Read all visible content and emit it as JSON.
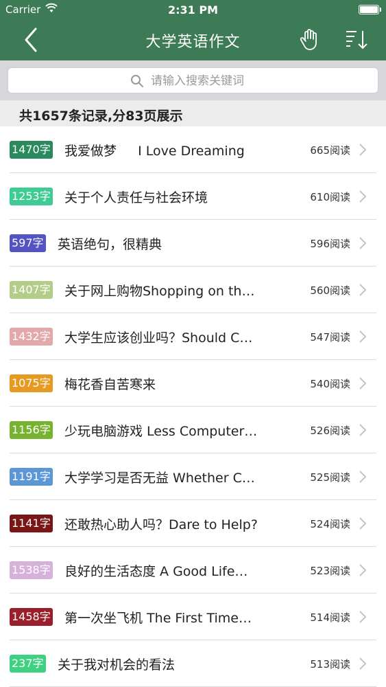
{
  "status": {
    "carrier": "Carrier",
    "time": "2:31 PM"
  },
  "nav": {
    "title": "大学英语作文",
    "icons": [
      "back-arrow-icon",
      "hand-icon",
      "sort-descending-icon"
    ]
  },
  "search": {
    "placeholder": "请输入搜索关键词"
  },
  "summary": "共1657条记录,分83页展示",
  "accent": "#3d7a56",
  "items": [
    {
      "badge": "1470字",
      "color": "#2a8a5e",
      "title": "我爱做梦 　 I Love Dreaming",
      "reads": "665阅读"
    },
    {
      "badge": "1253字",
      "color": "#3ecb94",
      "title": "关于个人责任与社会环境",
      "reads": "610阅读"
    },
    {
      "badge": "597字",
      "color": "#5354c4",
      "title": "英语绝句，很精典",
      "reads": "596阅读"
    },
    {
      "badge": "1407字",
      "color": "#b4cc8a",
      "title": "关于网上购物Shopping on th…",
      "reads": "560阅读"
    },
    {
      "badge": "1432字",
      "color": "#e3a9a9",
      "title": "大学生应该创业吗？Should C…",
      "reads": "547阅读"
    },
    {
      "badge": "1075字",
      "color": "#e79a22",
      "title": "梅花香自苦寒来",
      "reads": "540阅读"
    },
    {
      "badge": "1156字",
      "color": "#78b231",
      "title": "少玩电脑游戏 Less Computer…",
      "reads": "526阅读"
    },
    {
      "badge": "1191字",
      "color": "#5b96d6",
      "title": "大学学习是否无益 Whether C…",
      "reads": "525阅读"
    },
    {
      "badge": "1141字",
      "color": "#7a1616",
      "title": "还敢热心助人吗？Dare to Help?",
      "reads": "524阅读"
    },
    {
      "badge": "1538字",
      "color": "#d7b1d9",
      "title": "良好的生活态度 A Good Life…",
      "reads": "523阅读"
    },
    {
      "badge": "1458字",
      "color": "#9a1f2a",
      "title": "第一次坐飞机 The First Time…",
      "reads": "514阅读"
    },
    {
      "badge": "237字",
      "color": "#3fd182",
      "title": "关于我对机会的看法",
      "reads": "513阅读"
    }
  ]
}
